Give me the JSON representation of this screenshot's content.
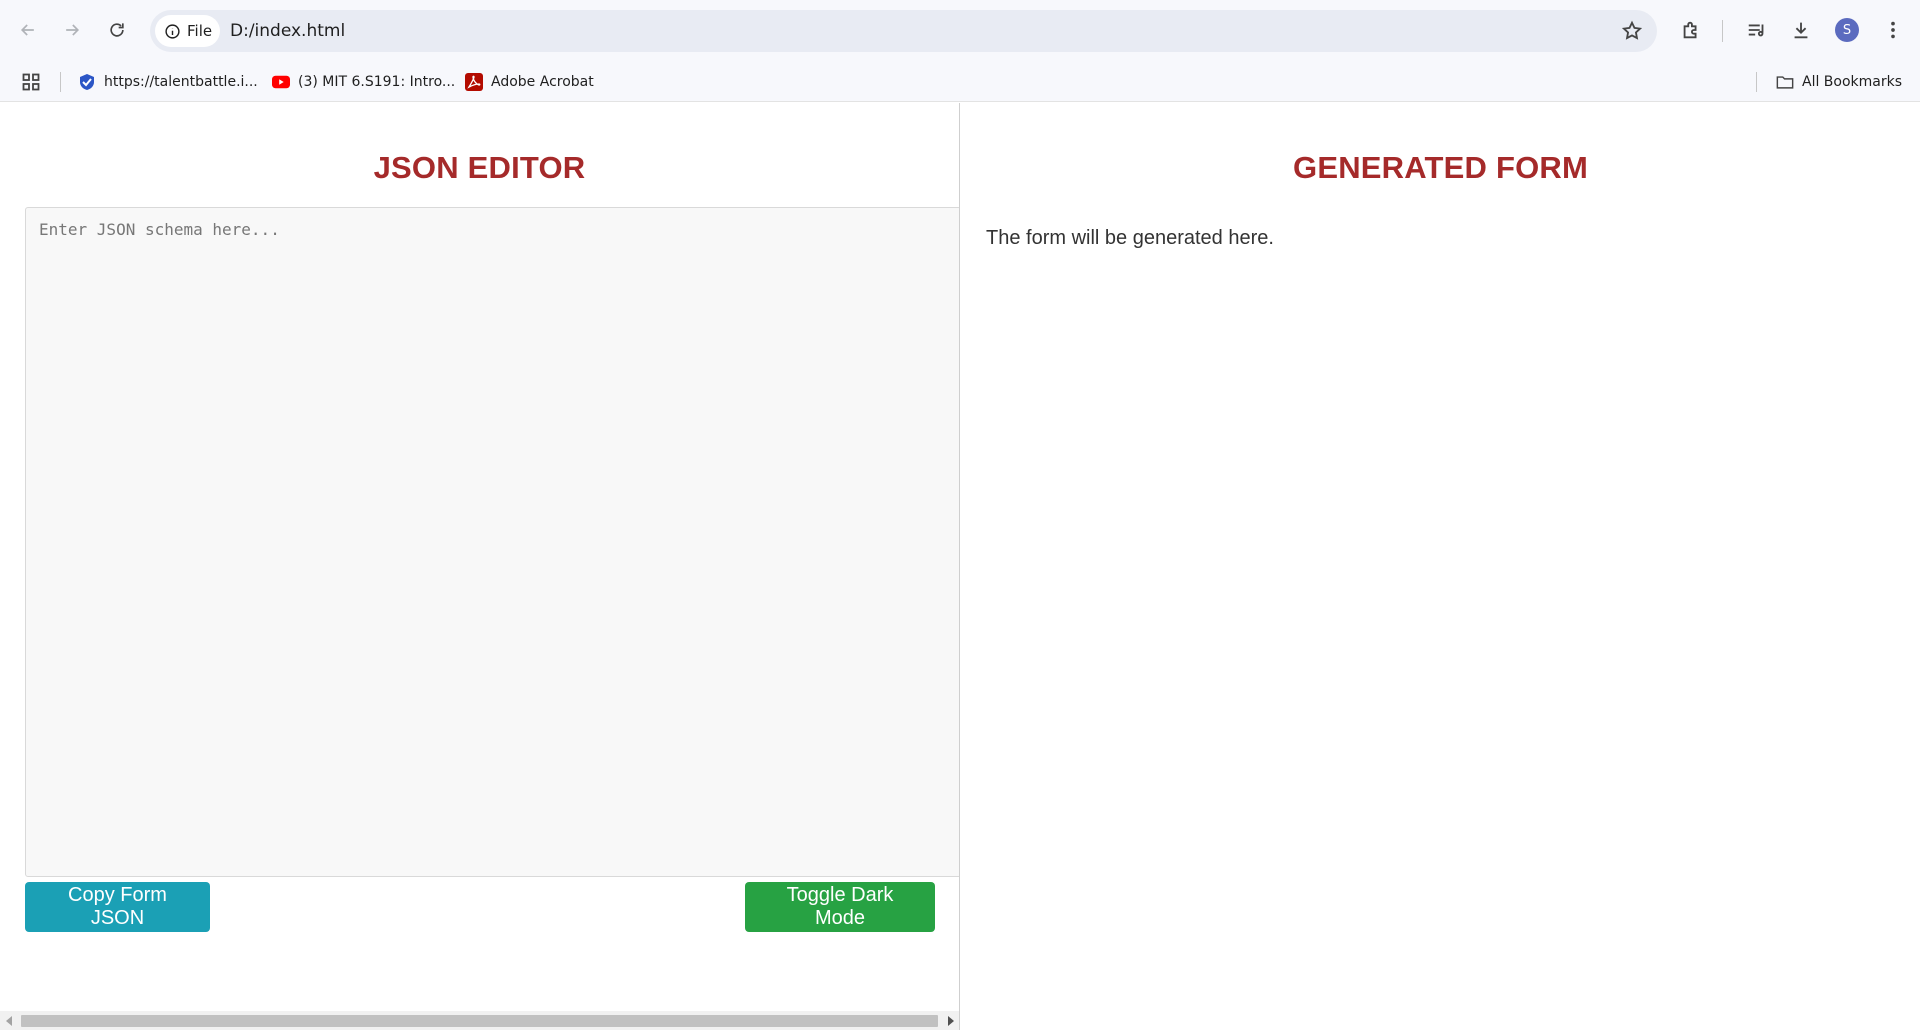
{
  "browser": {
    "site_chip_label": "File",
    "url": "D:/index.html",
    "profile_initial": "S",
    "bookmarks": [
      {
        "label": "https://talentbattle.i...",
        "icon": "talentbattle-favicon"
      },
      {
        "label": "(3) MIT 6.S191: Intro...",
        "icon": "youtube-favicon"
      },
      {
        "label": "Adobe Acrobat",
        "icon": "acrobat-favicon"
      }
    ],
    "all_bookmarks_label": "All Bookmarks"
  },
  "editor": {
    "title": "JSON EDITOR",
    "placeholder": "Enter JSON schema here...",
    "value": "",
    "copy_button": "Copy Form JSON",
    "dark_mode_button": "Toggle Dark Mode"
  },
  "form": {
    "title": "GENERATED FORM",
    "empty_message": "The form will be generated here."
  },
  "colors": {
    "heading": "#a52a2a",
    "copy_button": "#1ba0b5",
    "dark_mode_button": "#27a243"
  }
}
